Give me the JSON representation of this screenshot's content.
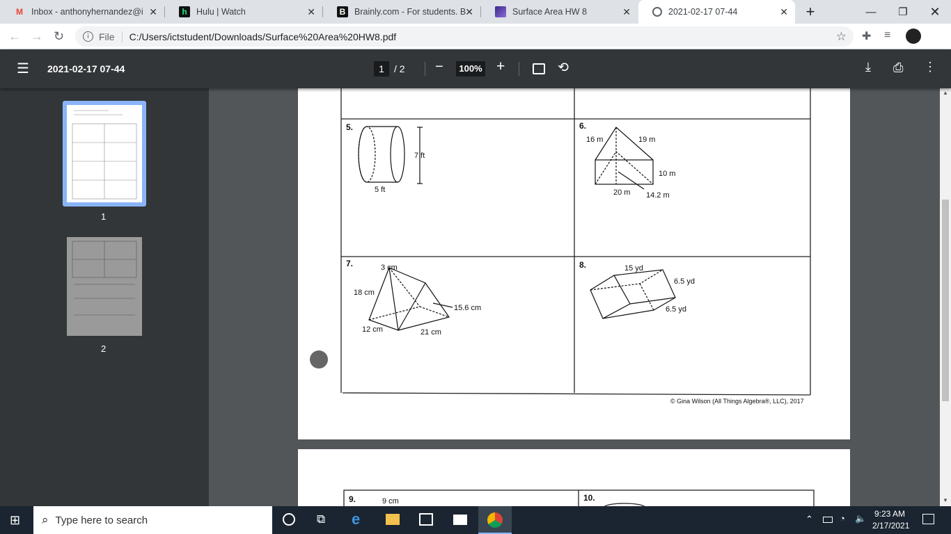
{
  "tabs": [
    {
      "label": "Inbox - anthonyhernandez@ict",
      "icon": "gmail-icon",
      "color": "#ea4335",
      "glyph": "M"
    },
    {
      "label": "Hulu | Watch",
      "icon": "hulu-icon",
      "color": "#1ce783",
      "glyph": "h"
    },
    {
      "label": "Brainly.com - For students. By s",
      "icon": "brainly-icon",
      "color": "#000000",
      "glyph": "B"
    },
    {
      "label": "Surface Area HW 8",
      "icon": "image-icon",
      "color": "#5b3fa8",
      "glyph": ""
    },
    {
      "label": "2021-02-17 07-44",
      "icon": "globe-icon",
      "color": "#5f6368",
      "glyph": ""
    }
  ],
  "address": {
    "scheme": "File",
    "url": "C:/Users/ictstudent/Downloads/Surface%20Area%20HW8.pdf"
  },
  "pdf": {
    "title": "2021-02-17 07-44",
    "page": "1",
    "total": "/ 2",
    "zoom": "100%"
  },
  "thumbs": [
    "1",
    "2"
  ],
  "problems": {
    "p5": {
      "num": "5.",
      "h": "7 ft",
      "d": "5 ft"
    },
    "p6": {
      "num": "6.",
      "a": "16 m",
      "b": "19 m",
      "c": "10 m",
      "d": "20 m",
      "e": "14.2 m"
    },
    "p7": {
      "num": "7.",
      "a": "3 cm",
      "b": "18 cm",
      "c": "15.6 cm",
      "d": "12 cm",
      "e": "21 cm"
    },
    "p8": {
      "num": "8.",
      "a": "15 yd",
      "b": "6.5 yd",
      "c": "6.5 yd"
    },
    "p9": {
      "num": "9.",
      "a": "9 cm"
    },
    "p10": {
      "num": "10."
    }
  },
  "copyright": "© Gina Wilson (All Things Algebra®, LLC), 2017",
  "taskbar": {
    "search": "Type here to search",
    "time": "9:23 AM",
    "date": "2/17/2021"
  }
}
